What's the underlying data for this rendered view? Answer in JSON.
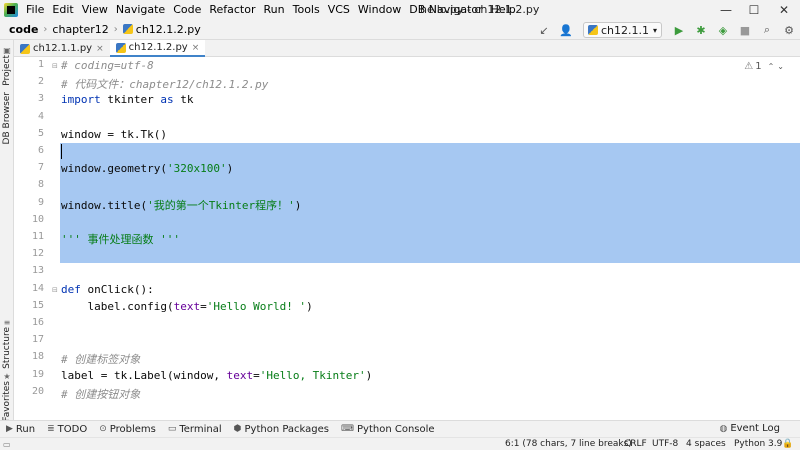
{
  "menubar": {
    "items": [
      "File",
      "Edit",
      "View",
      "Navigate",
      "Code",
      "Refactor",
      "Run",
      "Tools",
      "VCS",
      "Window",
      "DB Navigator",
      "Help"
    ],
    "window_title": "hello.py - ch12.1.2.py",
    "controls": {
      "minimize": "—",
      "maximize": "☐",
      "close": "✕"
    }
  },
  "navbar": {
    "breadcrumbs": [
      "code",
      "chapter12",
      "ch12.1.2.py"
    ],
    "run_config": "ch12.1.1",
    "icons": [
      "back-arrow-icon",
      "user-icon",
      "run-icon",
      "debug-icon",
      "coverage-icon",
      "stop-icon",
      "search-icon",
      "settings-icon"
    ]
  },
  "leftstripe": {
    "tabs": [
      "Project",
      "DB Browser",
      "Structure",
      "Favorites"
    ]
  },
  "tabs": [
    {
      "label": "ch12.1.1.py",
      "active": false
    },
    {
      "label": "ch12.1.2.py",
      "active": true
    }
  ],
  "editor": {
    "inspection_count": "1",
    "lines": [
      {
        "n": "1",
        "html": "<span class='comment'># coding=utf-8</span>"
      },
      {
        "n": "2",
        "html": "<span class='comment'># 代码文件：chapter12/ch12.1.2.py</span>"
      },
      {
        "n": "3",
        "html": "<span class='kw'>import</span> tkinter <span class='kw'>as</span> tk"
      },
      {
        "n": "4",
        "html": ""
      },
      {
        "n": "5",
        "html": "window = tk.Tk()"
      },
      {
        "n": "6",
        "html": ""
      },
      {
        "n": "7",
        "html": "window.geometry(<span class='str'>'320x100'</span>)"
      },
      {
        "n": "8",
        "html": ""
      },
      {
        "n": "9",
        "html": "window.title(<span class='str'>'我的第一个Tkinter程序！'</span>)"
      },
      {
        "n": "10",
        "html": ""
      },
      {
        "n": "11",
        "html": "<span class='str'>''' 事件处理函数 '''</span>"
      },
      {
        "n": "12",
        "html": ""
      },
      {
        "n": "13",
        "html": ""
      },
      {
        "n": "14",
        "html": "<span class='kw'>def</span> onClick():"
      },
      {
        "n": "15",
        "html": "    label.config(<span class='kwarg'>text</span>=<span class='str'>'Hello World! '</span>)"
      },
      {
        "n": "16",
        "html": ""
      },
      {
        "n": "17",
        "html": ""
      },
      {
        "n": "18",
        "html": "<span class='comment'># 创建标签对象</span>"
      },
      {
        "n": "19",
        "html": "label = tk.Label(window, <span class='kwarg'>text</span>=<span class='str'>'Hello, Tkinter'</span>)"
      },
      {
        "n": "20",
        "html": "<span class='comment'># 创建按钮对象</span>"
      }
    ]
  },
  "bottom_tools": [
    {
      "label": "Run",
      "icon": "run-icon"
    },
    {
      "label": "TODO",
      "icon": "todo-icon"
    },
    {
      "label": "Problems",
      "icon": "problems-icon"
    },
    {
      "label": "Terminal",
      "icon": "terminal-icon"
    },
    {
      "label": "Python Packages",
      "icon": "packages-icon"
    },
    {
      "label": "Python Console",
      "icon": "console-icon"
    }
  ],
  "event_log": "Event Log",
  "status": {
    "position": "6:1 (78 chars, 7 line breaks)",
    "line_sep": "CRLF",
    "encoding": "UTF-8",
    "indent": "4 spaces",
    "interpreter": "Python 3.9"
  },
  "colors": {
    "selection": "#a6c8f2",
    "keyword": "#0033b3",
    "string": "#067d17",
    "comment": "#8c8c8c"
  }
}
